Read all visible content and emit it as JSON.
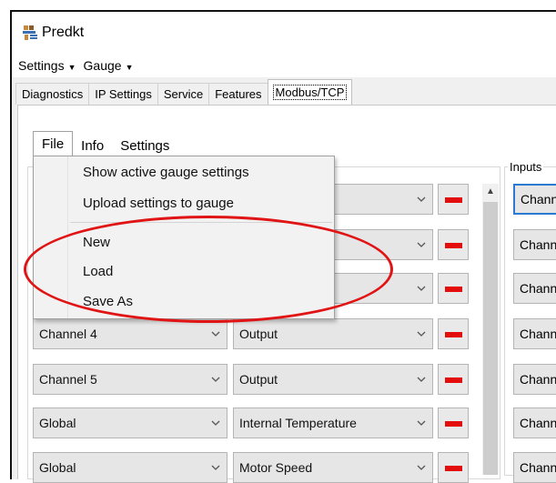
{
  "window": {
    "title": "Predkt"
  },
  "menubar": {
    "items": [
      "Settings",
      "Gauge"
    ]
  },
  "tabs": [
    "Diagnostics",
    "IP Settings",
    "Service",
    "Features",
    "Modbus/TCP"
  ],
  "subtabs": [
    "File",
    "Info",
    "Settings"
  ],
  "file_menu": {
    "items": [
      "Show active gauge settings",
      "Upload settings to gauge",
      "New",
      "Load",
      "Save As"
    ]
  },
  "inputs_label": "Inputs",
  "rows": [
    {
      "channel": "",
      "mode": ""
    },
    {
      "channel": "",
      "mode": ""
    },
    {
      "channel": "",
      "mode": ""
    },
    {
      "channel": "Channel 4",
      "mode": "Output"
    },
    {
      "channel": "Channel 5",
      "mode": "Output"
    },
    {
      "channel": "Global",
      "mode": "Internal Temperature"
    },
    {
      "channel": "Global",
      "mode": "Motor Speed"
    }
  ],
  "input_rows": [
    "Chann",
    "Chann",
    "Chann",
    "Chann",
    "Chann",
    "Chann",
    "Chann"
  ],
  "colors": {
    "accent_focus": "#2a7ad4",
    "status_red": "#e30d0d",
    "annotation_red": "#e01414"
  }
}
